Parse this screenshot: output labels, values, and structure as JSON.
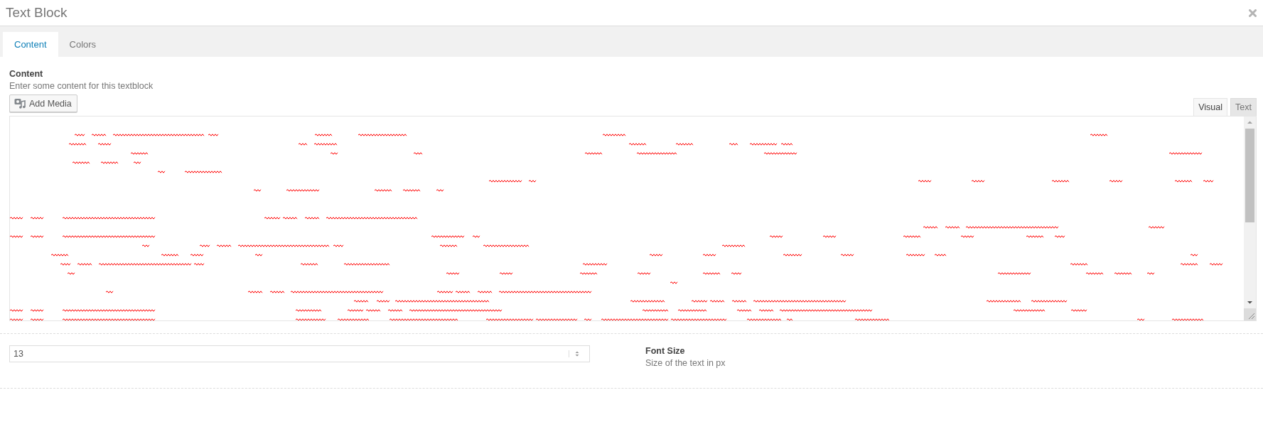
{
  "dialog": {
    "title": "Text Block"
  },
  "tabs": [
    {
      "label": "Content",
      "selected": true
    },
    {
      "label": "Colors",
      "selected": false
    }
  ],
  "content_field": {
    "label": "Content",
    "description": "Enter some content for this textblock",
    "add_media_button": "Add Media",
    "editor_tabs": [
      {
        "label": "Visual",
        "selected": true
      },
      {
        "label": "Text",
        "selected": false
      }
    ]
  },
  "font_size_field": {
    "value": "13",
    "label": "Font Size",
    "description": "Size of the text in px"
  }
}
